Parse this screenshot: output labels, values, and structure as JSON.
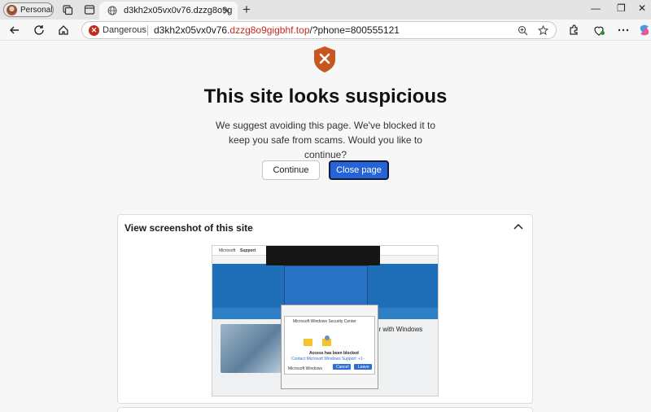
{
  "browser": {
    "profile_label": "Personal",
    "tab_title": "d3kh2x05vx0v76.dzzg8o9g",
    "security_label": "Dangerous",
    "url_host_black": "d3kh2x05vx0v76.",
    "url_host_red": "dzzg8o9gigbhf.top",
    "url_path": "/?phone=800555121",
    "colors": {
      "danger": "#c42b1c",
      "accent": "#2563d7",
      "shield": "#c8571f"
    }
  },
  "page": {
    "heading": "This site looks suspicious",
    "description": "We suggest avoiding this page. We've blocked it to keep you safe from scams. Would you like to continue?",
    "continue_label": "Continue",
    "close_label": "Close page"
  },
  "screenshot_card": {
    "title": "View screenshot of this site",
    "thumb": {
      "brand": "Microsoft",
      "support": "Support",
      "dialog_title": "Microsoft Windows Security Center",
      "access_blocked": "Access has been blocked",
      "contact_text": "Contact Microsoft Windows Support: +1-",
      "footer_brand": "Microsoft Windows",
      "cancel_label": "Cancel",
      "leave_label": "Leave",
      "side_heading": "er with Windows"
    }
  }
}
